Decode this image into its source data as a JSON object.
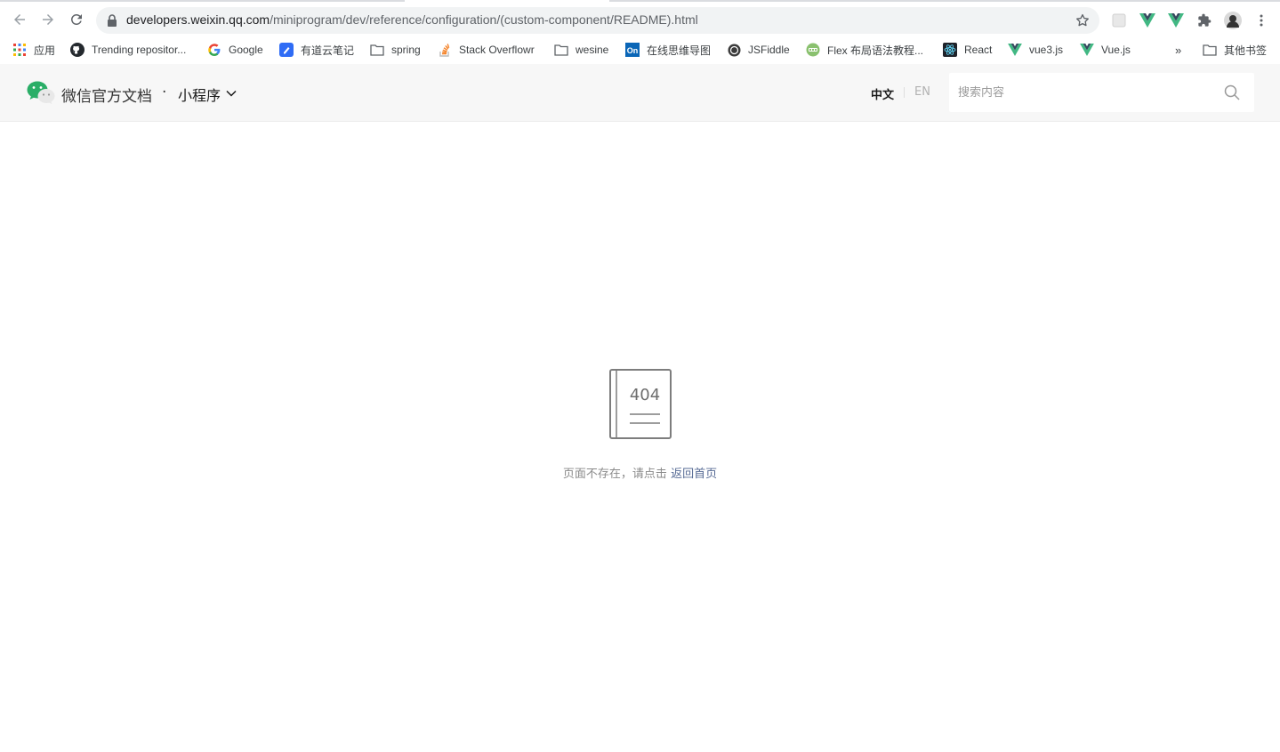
{
  "browser": {
    "url_host": "developers.weixin.qq.com",
    "url_path": "/miniprogram/dev/reference/configuration/(custom-component/README).html"
  },
  "bookmarks": [
    {
      "label": "应用",
      "icon": "apps-grid-icon"
    },
    {
      "label": "Trending repositor...",
      "icon": "github-icon"
    },
    {
      "label": "Google",
      "icon": "google-icon"
    },
    {
      "label": "有道云笔记",
      "icon": "youdao-note-icon"
    },
    {
      "label": "spring",
      "icon": "folder-icon"
    },
    {
      "label": "Stack Overflowr",
      "icon": "stackoverflow-icon"
    },
    {
      "label": "wesine",
      "icon": "folder-icon"
    },
    {
      "label": "在线思维导图",
      "icon": "mindmap-icon"
    },
    {
      "label": "JSFiddle",
      "icon": "jsfiddle-icon"
    },
    {
      "label": "Flex 布局语法教程...",
      "icon": "flex-icon"
    },
    {
      "label": "React",
      "icon": "react-icon"
    },
    {
      "label": "vue3.js",
      "icon": "vue-icon"
    },
    {
      "label": "Vue.js",
      "icon": "vue-icon"
    },
    {
      "label": "»",
      "icon": "more-bookmarks-icon"
    },
    {
      "label": "其他书签",
      "icon": "folder-icon"
    }
  ],
  "header": {
    "brand": "微信官方文档",
    "dot": "·",
    "product": "小程序",
    "lang_zh": "中文",
    "lang_en": "EN",
    "search_placeholder": "搜索内容"
  },
  "content": {
    "code": "404",
    "message": "页面不存在，请点击",
    "link": "返回首页"
  },
  "colors": {
    "wechat_green": "#2aae67",
    "link_blue": "#576b95"
  }
}
